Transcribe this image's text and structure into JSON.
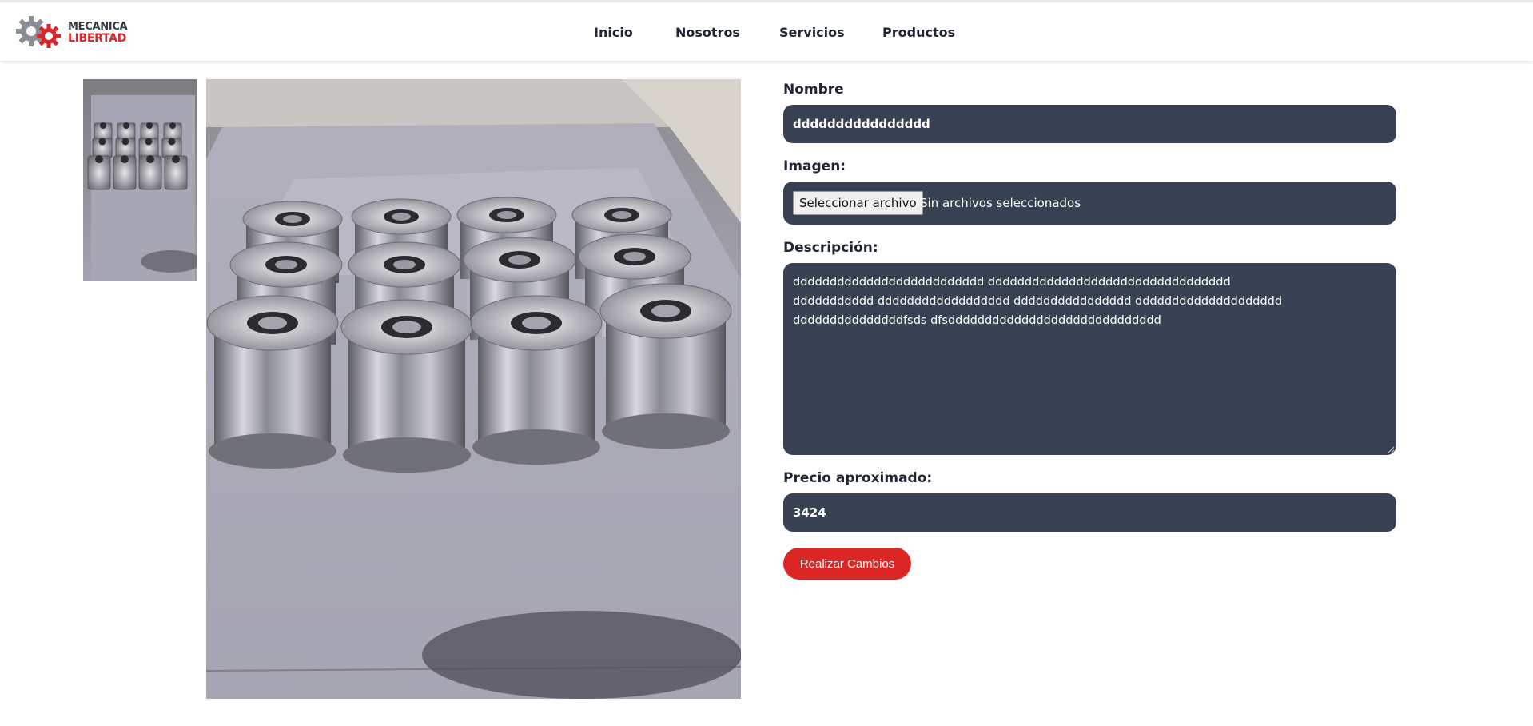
{
  "brand": {
    "line1": "MECANICA",
    "line2": "LIBERTAD",
    "logo_icon": "gears-icon",
    "accent": "#d9262c"
  },
  "nav": {
    "items": [
      {
        "label": "Inicio"
      },
      {
        "label": "Nosotros"
      },
      {
        "label": "Servicios"
      },
      {
        "label": "Productos"
      }
    ]
  },
  "gallery": {
    "thumbnail_icon": "product-thumbnail-image",
    "main_icon": "product-main-image"
  },
  "form": {
    "nombre": {
      "label": "Nombre",
      "value": "dddddddddddddddd"
    },
    "imagen": {
      "label": "Imagen:",
      "button_label": "Seleccionar archivo",
      "status": "Sin archivos seleccionados"
    },
    "descripcion": {
      "label": "Descripción:",
      "lines": [
        "dddddddddddddddddddddddddd ddddddddddddddddddddddddddddddddd",
        "ddddddddddd dddddddddddddddddd dddddddddddddddd dddddddddddddddddddd",
        "dddddddddddddddfsds dfsddddddddddddddddddddddddddddd"
      ]
    },
    "precio": {
      "label": "Precio aproximado:",
      "value": "3424"
    },
    "submit_label": "Realizar Cambios",
    "field_color": "#374151",
    "button_color": "#dc2626"
  }
}
